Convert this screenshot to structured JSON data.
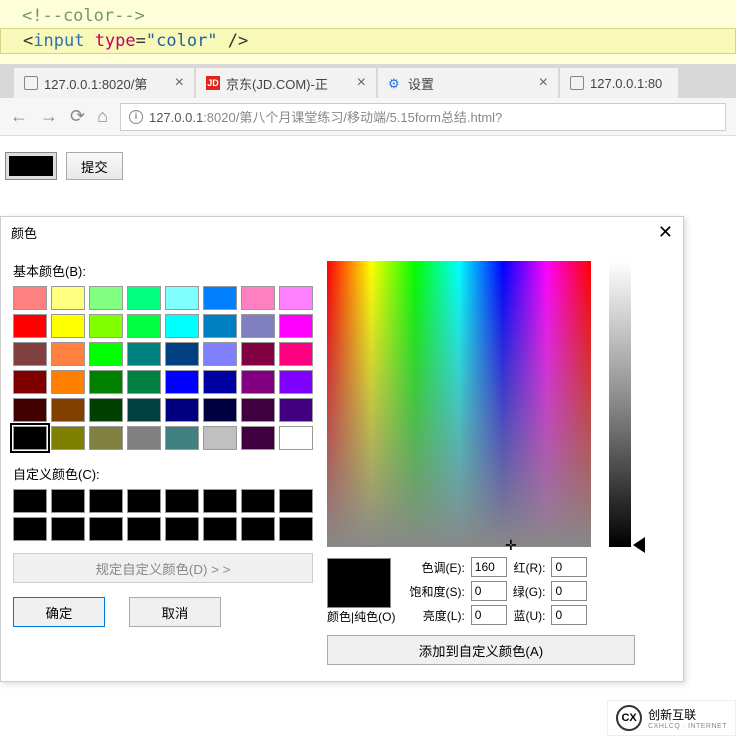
{
  "code": {
    "line1": "<!--color-->",
    "line2_tag": "input",
    "line2_attr": "type",
    "line2_val": "\"color\""
  },
  "tabs": [
    {
      "icon": "page",
      "title": "127.0.0.1:8020/第"
    },
    {
      "icon": "jd",
      "title": "京东(JD.COM)-正"
    },
    {
      "icon": "gear",
      "title": "设置"
    },
    {
      "icon": "page",
      "title": "127.0.0.1:80"
    }
  ],
  "address": {
    "host": "127.0.0.1",
    "port": ":8020",
    "path": "/第八个月课堂练习/移动端/5.15form总结.html?"
  },
  "page": {
    "submit": "提交"
  },
  "dialog": {
    "title": "颜色",
    "basic_label": "基本颜色(B):",
    "custom_label": "自定义颜色(C):",
    "define_label": "规定自定义颜色(D) > >",
    "ok": "确定",
    "cancel": "取消",
    "add": "添加到自定义颜色(A)",
    "preview_label": "颜色|纯色(O)",
    "fields": {
      "hue_l": "色调(E):",
      "hue_v": "160",
      "sat_l": "饱和度(S):",
      "sat_v": "0",
      "lum_l": "亮度(L):",
      "lum_v": "0",
      "r_l": "红(R):",
      "r_v": "0",
      "g_l": "绿(G):",
      "g_v": "0",
      "b_l": "蓝(U):",
      "b_v": "0"
    }
  },
  "basic_colors": [
    "#ff8080",
    "#ffff80",
    "#80ff80",
    "#00ff80",
    "#80ffff",
    "#0080ff",
    "#ff80c0",
    "#ff80ff",
    "#ff0000",
    "#ffff00",
    "#80ff00",
    "#00ff40",
    "#00ffff",
    "#0080c0",
    "#8080c0",
    "#ff00ff",
    "#804040",
    "#ff8040",
    "#00ff00",
    "#008080",
    "#004080",
    "#8080ff",
    "#800040",
    "#ff0080",
    "#800000",
    "#ff8000",
    "#008000",
    "#008040",
    "#0000ff",
    "#0000a0",
    "#800080",
    "#8000ff",
    "#400000",
    "#804000",
    "#004000",
    "#004040",
    "#000080",
    "#000040",
    "#400040",
    "#400080",
    "#000000",
    "#808000",
    "#808040",
    "#808080",
    "#408080",
    "#c0c0c0",
    "#400040",
    "#ffffff"
  ],
  "custom_colors": [
    "#000",
    "#000",
    "#000",
    "#000",
    "#000",
    "#000",
    "#000",
    "#000",
    "#000",
    "#000",
    "#000",
    "#000",
    "#000",
    "#000",
    "#000",
    "#000"
  ],
  "watermark": {
    "brand": "创新互联",
    "sub": "CXHLCQ · INTERNET"
  }
}
